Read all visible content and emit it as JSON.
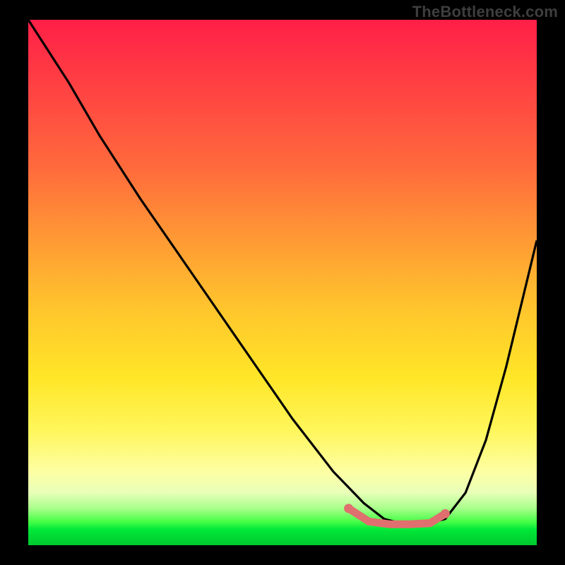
{
  "watermark": "TheBottleneck.com",
  "chart_data": {
    "type": "line",
    "title": "",
    "xlabel": "",
    "ylabel": "",
    "xlim": [
      0,
      100
    ],
    "ylim": [
      0,
      100
    ],
    "grid": false,
    "legend": false,
    "note": "Values are approximate pixel-percentage readings; x is horizontal position (0=left, 100=right), y is vertical position (0=top, 100=bottom). The main black curve descends from upper-left to a flat minimum near x≈70-80 then rises toward the right. A pale-red thick segment highlights the flat bottom.",
    "series": [
      {
        "name": "main-curve",
        "color": "#000000",
        "x": [
          0,
          4,
          8,
          14,
          22,
          32,
          42,
          52,
          60,
          66,
          70,
          74,
          78,
          82,
          86,
          90,
          94,
          98,
          100
        ],
        "y": [
          0,
          6,
          12,
          22,
          34,
          48,
          62,
          76,
          86,
          92,
          95,
          96,
          96,
          95,
          90,
          80,
          66,
          50,
          42
        ]
      },
      {
        "name": "highlight-bottom",
        "color": "#e06f6f",
        "x": [
          63,
          67,
          71,
          75,
          79,
          82
        ],
        "y": [
          93,
          95.5,
          96,
          96,
          95.8,
          94
        ]
      }
    ],
    "gradient_stops": [
      {
        "pos": 0.0,
        "color": "#ff1f47"
      },
      {
        "pos": 0.28,
        "color": "#ff6a3c"
      },
      {
        "pos": 0.55,
        "color": "#ffc52d"
      },
      {
        "pos": 0.78,
        "color": "#fff65a"
      },
      {
        "pos": 0.9,
        "color": "#e8ffb8"
      },
      {
        "pos": 0.96,
        "color": "#47ff47"
      },
      {
        "pos": 1.0,
        "color": "#00c82f"
      }
    ]
  }
}
